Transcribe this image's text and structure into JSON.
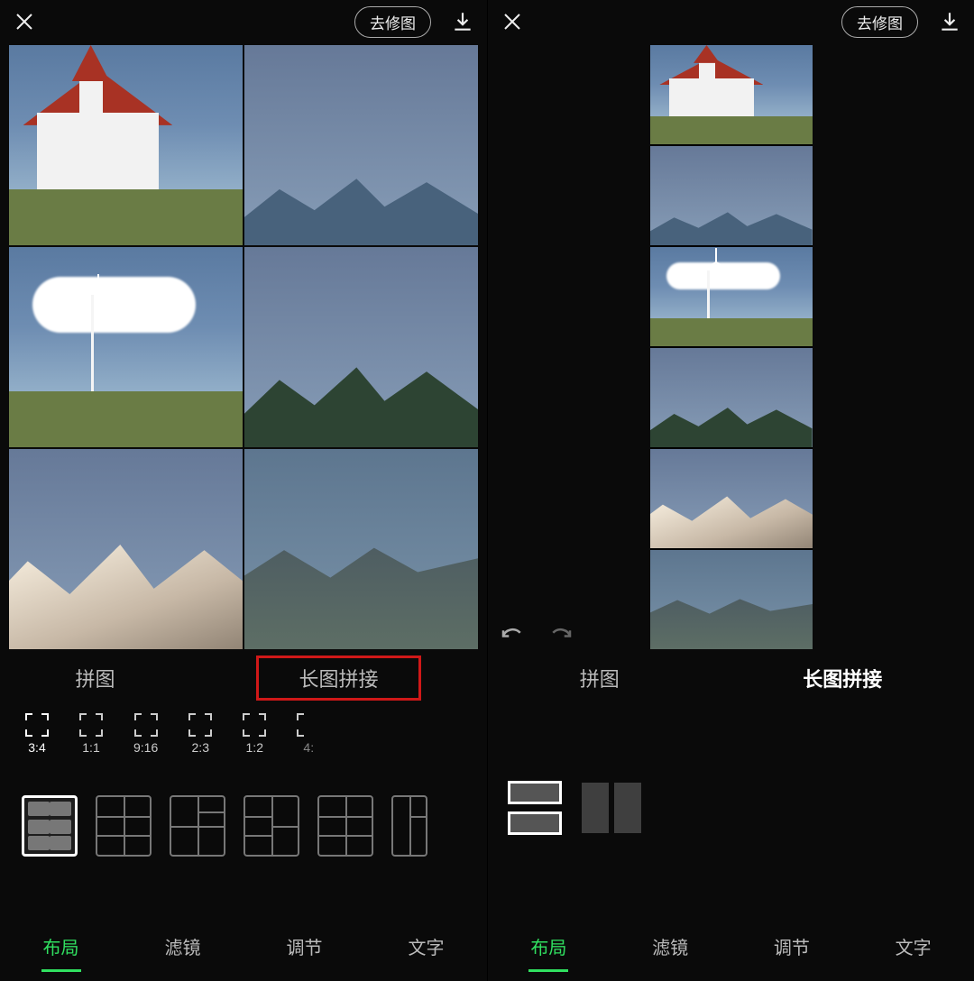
{
  "accent": "#30e060",
  "left": {
    "go_edit_label": "去修图",
    "tabs": [
      "拼图",
      "长图拼接"
    ],
    "tabs_highlight_index": 1,
    "ratios": [
      "3:4",
      "1:1",
      "9:16",
      "2:3",
      "1:2",
      "4:"
    ],
    "active_ratio_index": 0,
    "bottom_nav": [
      "布局",
      "滤镜",
      "调节",
      "文字"
    ],
    "bottom_nav_active_index": 0,
    "layout_templates": [
      "grid-2x3",
      "grid-2x3-alt",
      "grid-mixed-1",
      "grid-mixed-2",
      "grid-2x2-tall",
      "grid-col-mixed"
    ],
    "layout_templates_active_index": 0,
    "canvas_tiles": [
      "church",
      "mountain-lake",
      "windmill-clouds",
      "snow-mountain-forest",
      "snow-peak",
      "ridge-lake"
    ]
  },
  "right": {
    "go_edit_label": "去修图",
    "tabs": [
      "拼图",
      "长图拼接"
    ],
    "tabs_active_index": 1,
    "layout_templates": [
      "vertical-stack",
      "horizontal-stack"
    ],
    "layout_templates_active_index": 0,
    "bottom_nav": [
      "布局",
      "滤镜",
      "调节",
      "文字"
    ],
    "bottom_nav_active_index": 0,
    "strip_tiles": [
      "church",
      "mountain-lake",
      "windmill-clouds",
      "snow-mountain-forest",
      "snow-peak",
      "ridge-lake"
    ]
  }
}
